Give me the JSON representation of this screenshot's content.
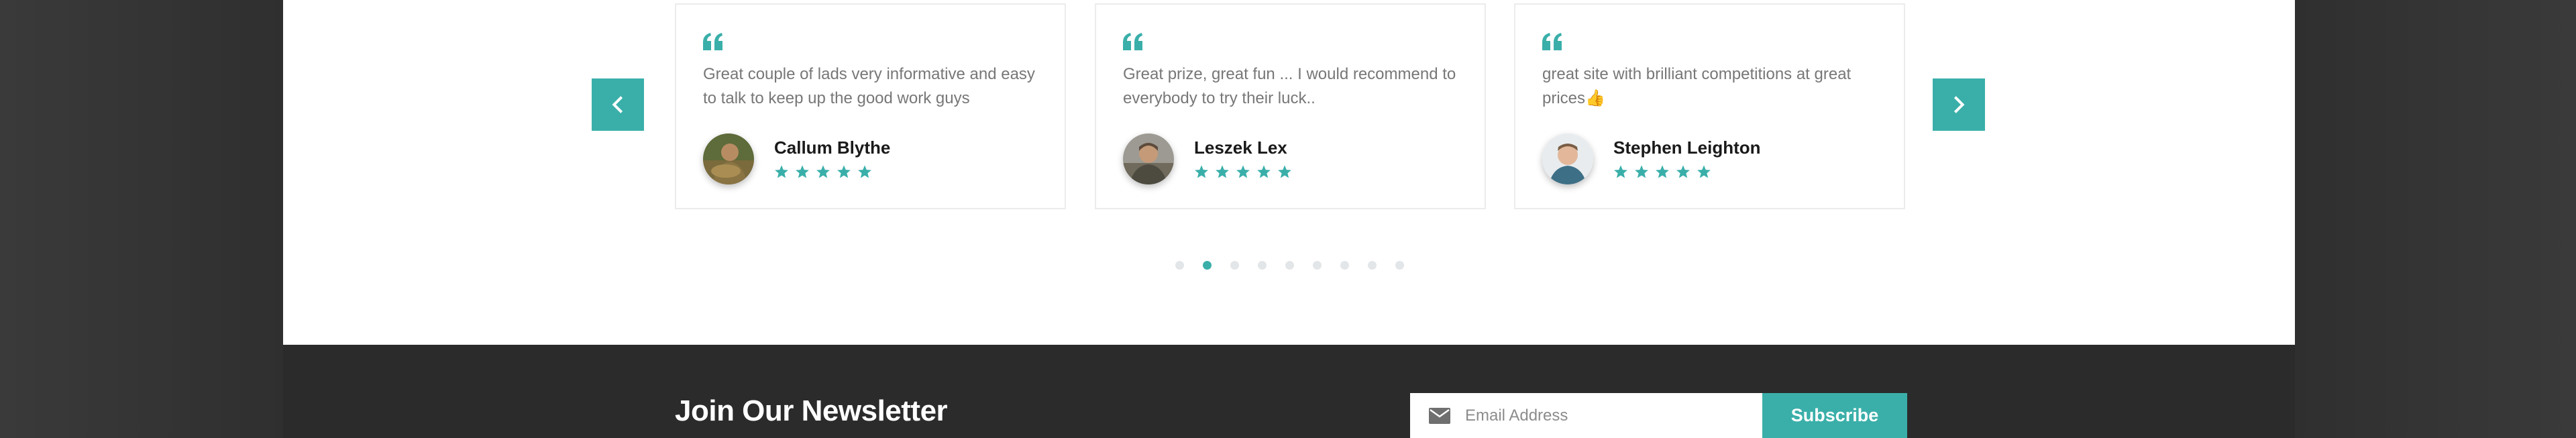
{
  "testimonials": [
    {
      "text": "Great couple of lads very informative and easy to talk to keep up the good work guys",
      "name": "Callum Blythe",
      "rating": 5
    },
    {
      "text": "Great prize, great fun ... I would recommend to everybody to try their luck..",
      "name": "Leszek Lex",
      "rating": 5
    },
    {
      "text": "great site with brilliant competitions at great prices👍",
      "name": "Stephen Leighton",
      "rating": 5
    }
  ],
  "carousel": {
    "prev_icon": "chevron-left-icon",
    "next_icon": "chevron-right-icon",
    "dot_count": 9,
    "active_dot": 2
  },
  "newsletter": {
    "title": "Join Our Newsletter",
    "email_placeholder": "Email Address",
    "subscribe_label": "Subscribe"
  },
  "colors": {
    "accent": "#3aafa9",
    "footer_bg": "#2b2b2b",
    "text_muted": "#777777"
  }
}
